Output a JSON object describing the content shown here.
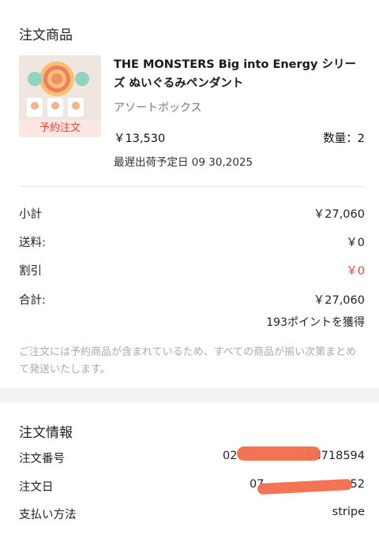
{
  "order_items": {
    "title": "注文商品",
    "thumbnail_tag": "予約注文",
    "product_name": "THE MONSTERS Big into Energy シリーズ ぬいぐるみペンダント",
    "variant": "アソートボックス",
    "price": "￥13,530",
    "quantity": "数量：2",
    "ship_date": "最遅出荷予定日 09 30,2025"
  },
  "summary": {
    "subtotal_label": "小計",
    "subtotal_value": "￥27,060",
    "shipping_label": "送料:",
    "shipping_value": "￥0",
    "discount_label": "割引",
    "discount_value": "￥0",
    "total_label": "合計:",
    "total_value": "￥27,060",
    "points": "193ポイントを獲得",
    "note": "ご注文には予約商品が含まれているため、すべての商品が揃い次第まとめて発送いたします。"
  },
  "order_info": {
    "title": "注文情報",
    "number_label": "注文番号",
    "number_value_start": "02",
    "number_value_end": "58718594",
    "date_label": "注文日",
    "date_value_start": "07",
    "date_value_end": ":52",
    "payment_label": "支払い方法",
    "payment_value": "stripe"
  },
  "colors": {
    "accent_red": "#e0453a",
    "redaction": "#f26d4b"
  }
}
